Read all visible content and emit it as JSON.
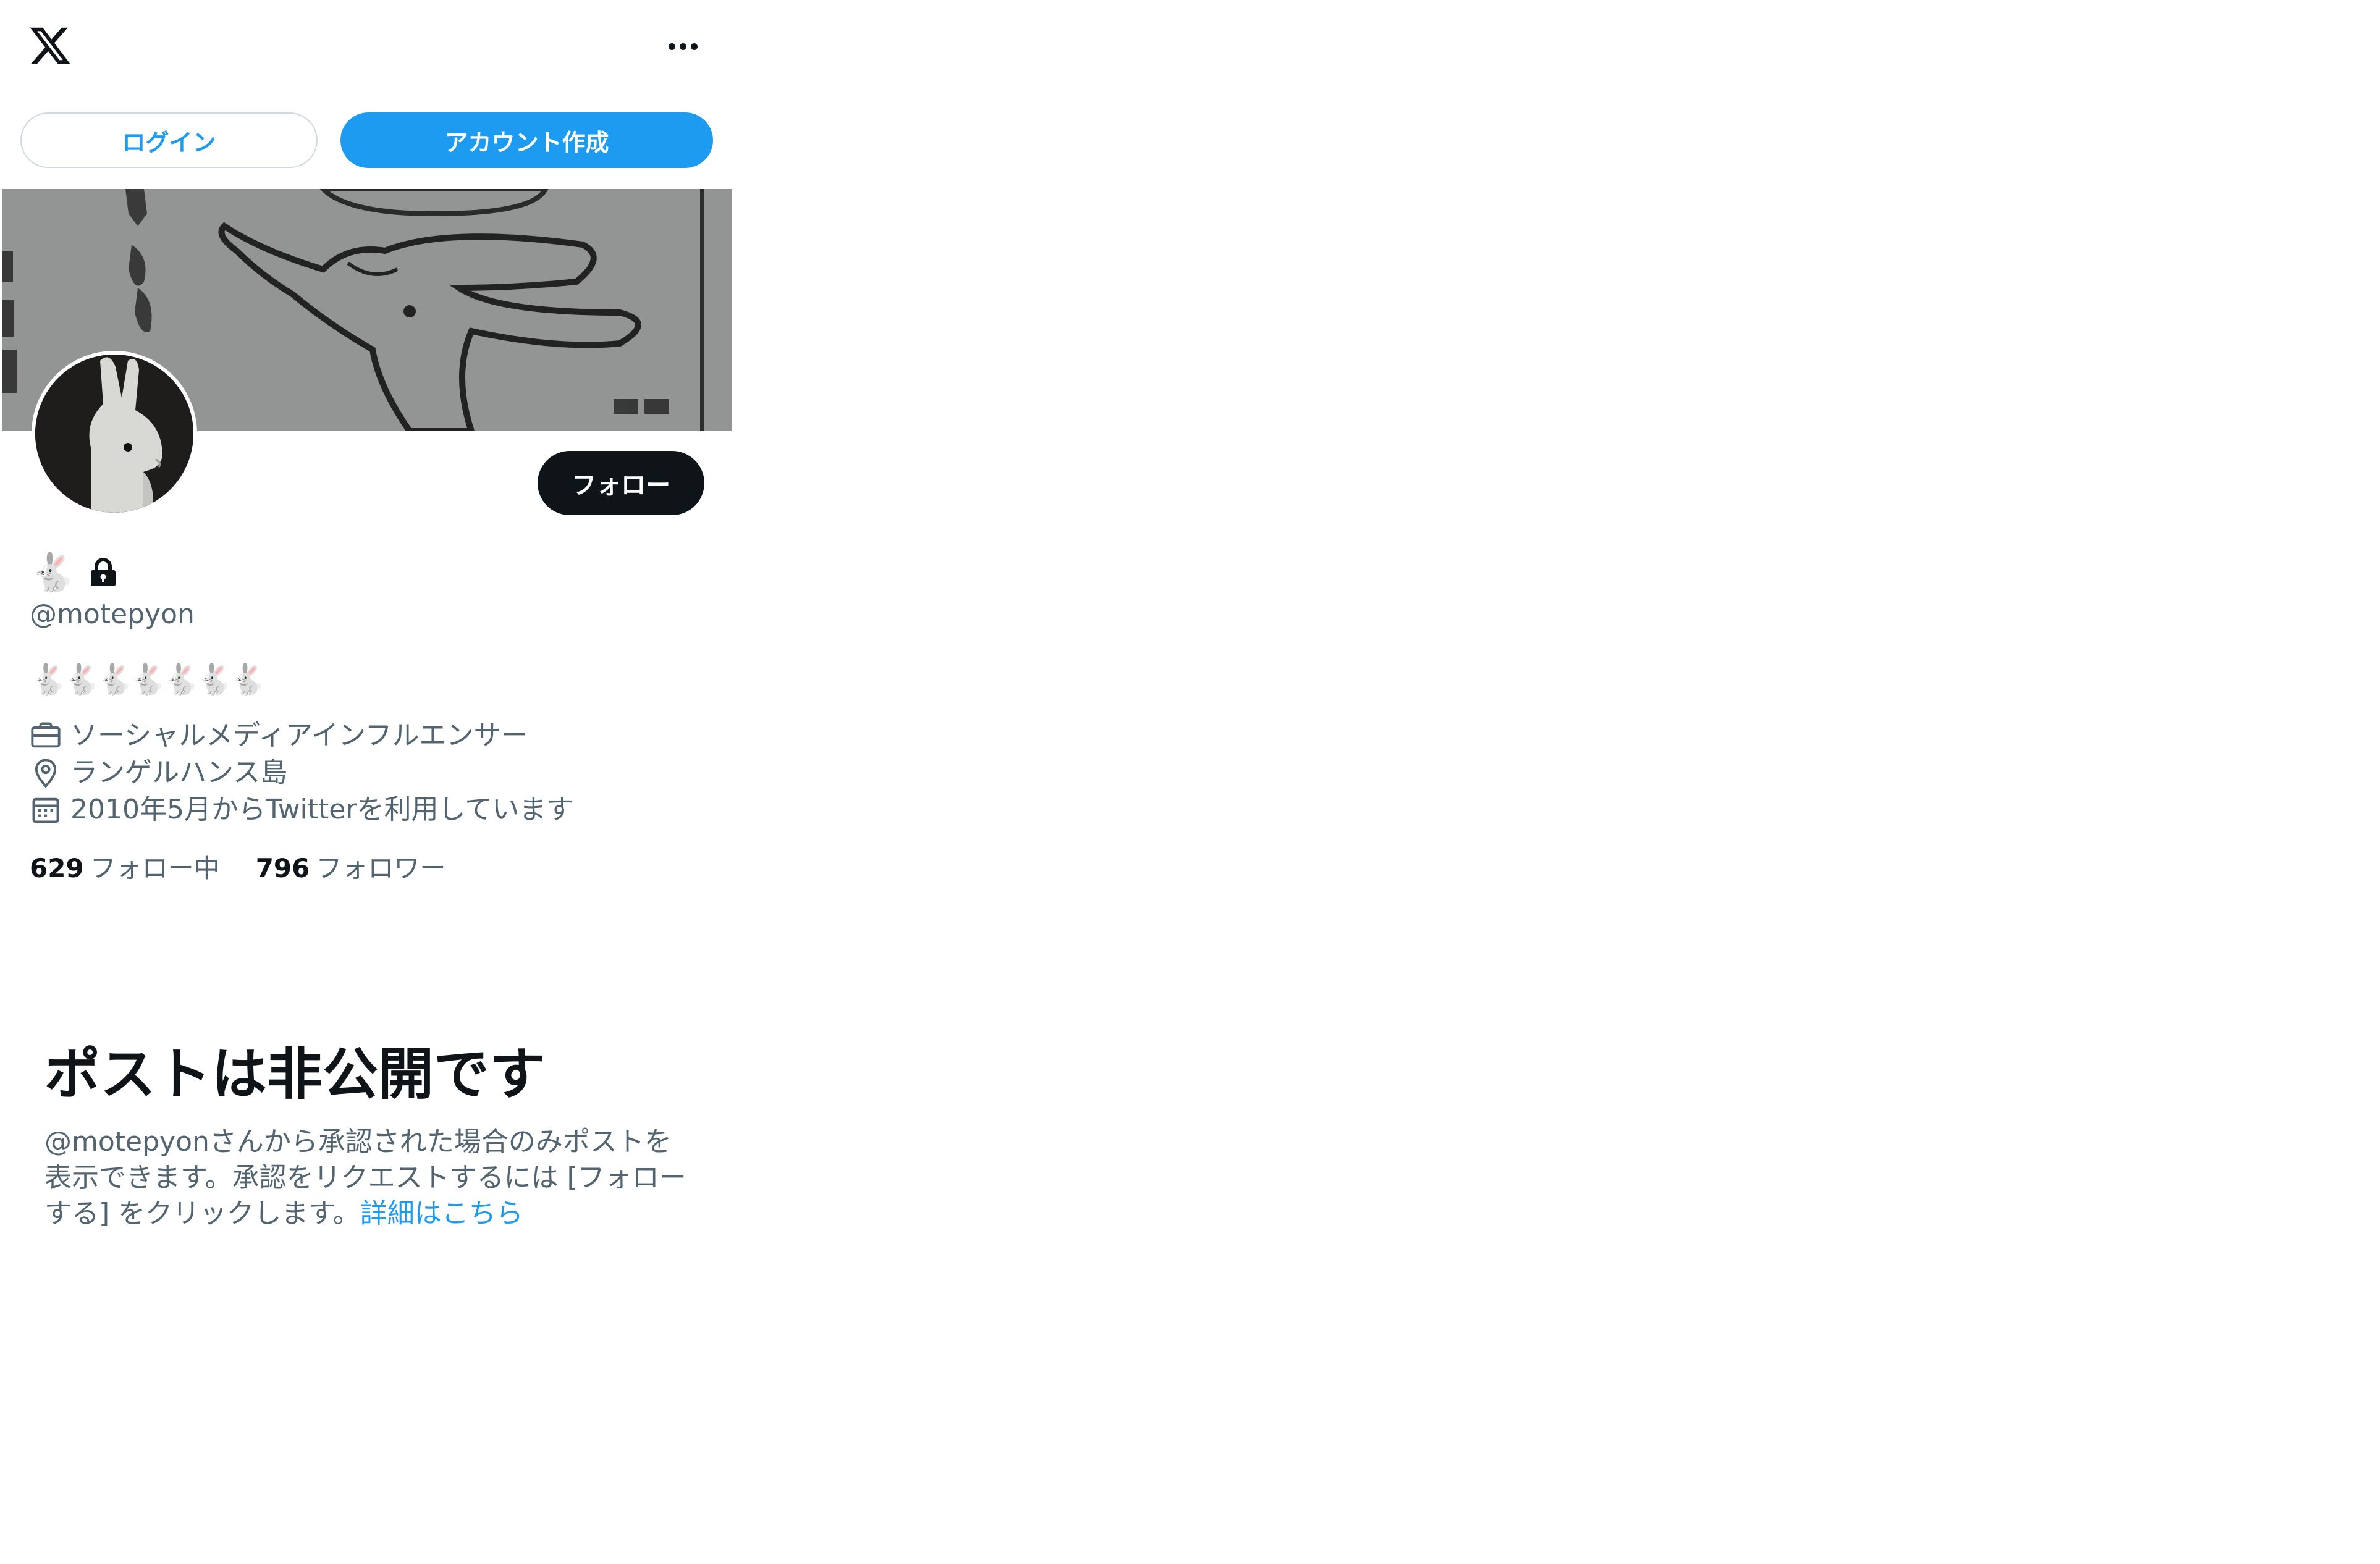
{
  "header": {
    "logo_icon": "x-logo-icon",
    "more_icon": "more-dots-icon",
    "login_label": "ログイン",
    "signup_label": "アカウント作成"
  },
  "profile": {
    "banner_image": "rabbit-illustration-banner",
    "avatar_image": "white-rabbit-figurine-avatar",
    "follow_label": "フォロー",
    "display_name": "🐇",
    "locked_icon": "lock-icon",
    "handle": "@motepyon",
    "bio": "🐇🐇🐇🐇🐇🐇🐇",
    "occupation": "ソーシャルメディアインフルエンサー",
    "location": "ランゲルハンス島",
    "joined": "2010年5月からTwitterを利用しています",
    "following_count": "629",
    "following_label": "フォロー中",
    "followers_count": "796",
    "followers_label": "フォロワー"
  },
  "private_notice": {
    "title": "ポストは非公開です",
    "body": "@motepyonさんから承認された場合のみポストを表示できます。承認をリクエストするには [フォローする] をクリックします。",
    "link_label": "詳細はこちら"
  },
  "colors": {
    "accent": "#1d9bf0",
    "text_primary": "#0f1419",
    "text_secondary": "#536471",
    "border": "#cfd9de"
  }
}
